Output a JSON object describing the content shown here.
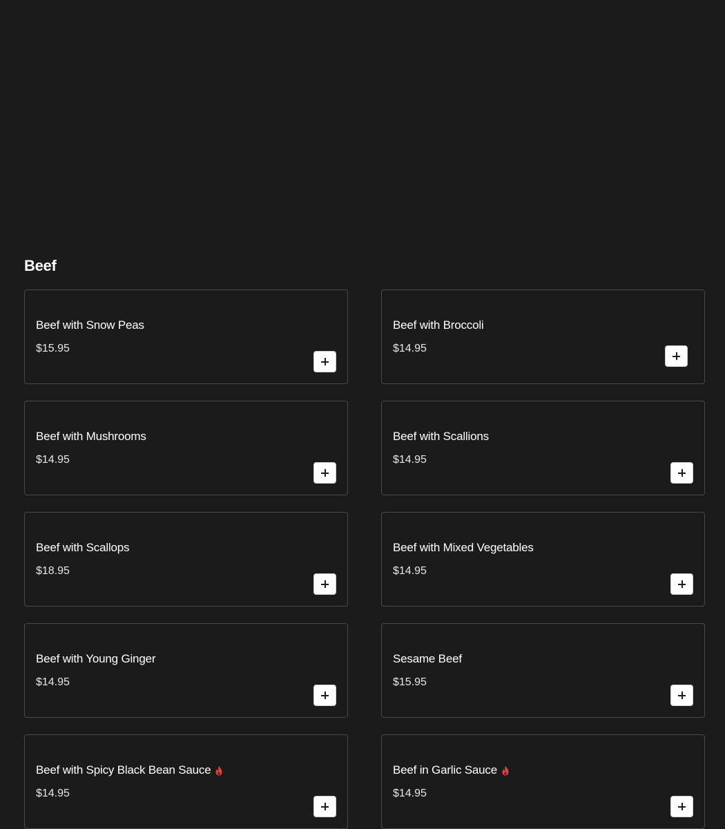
{
  "section": {
    "title": "Beef"
  },
  "items": [
    {
      "name": "Beef with Snow Peas",
      "price": "$15.95",
      "spicy": false
    },
    {
      "name": "Beef with Broccoli",
      "price": "$14.95",
      "spicy": false
    },
    {
      "name": "Beef with Mushrooms",
      "price": "$14.95",
      "spicy": false
    },
    {
      "name": "Beef with Scallions",
      "price": "$14.95",
      "spicy": false
    },
    {
      "name": "Beef with Scallops",
      "price": "$18.95",
      "spicy": false
    },
    {
      "name": "Beef with Mixed Vegetables",
      "price": "$14.95",
      "spicy": false
    },
    {
      "name": "Beef with Young Ginger",
      "price": "$14.95",
      "spicy": false
    },
    {
      "name": "Sesame Beef",
      "price": "$15.95",
      "spicy": false
    },
    {
      "name": "Beef with Spicy Black Bean Sauce",
      "price": "$14.95",
      "spicy": true
    },
    {
      "name": "Beef in Garlic Sauce",
      "price": "$14.95",
      "spicy": true
    }
  ],
  "colors": {
    "background": "#1b1b1b",
    "card_border": "#4a4a4a",
    "spicy": "#e0443a",
    "button_bg": "#ffffff"
  },
  "icons": {
    "add": "plus-icon",
    "spicy": "flame-icon"
  }
}
